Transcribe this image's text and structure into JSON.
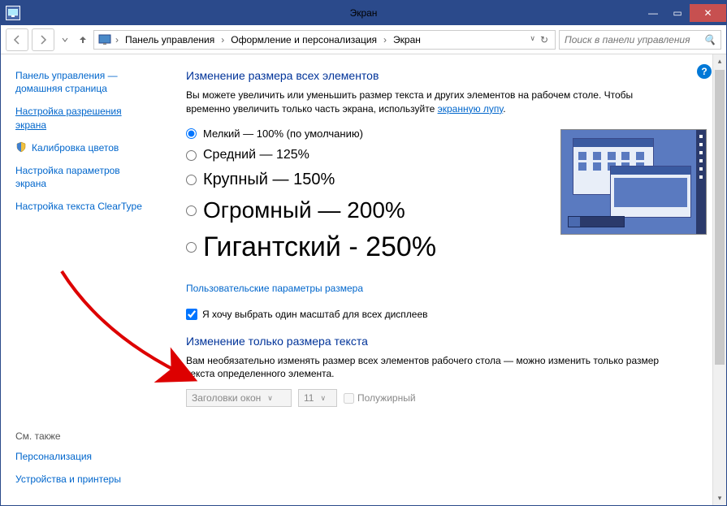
{
  "window": {
    "title": "Экран"
  },
  "breadcrumb": {
    "root": "Панель управления",
    "mid": "Оформление и персонализация",
    "leaf": "Экран"
  },
  "search": {
    "placeholder": "Поиск в панели управления"
  },
  "sidebar": {
    "home1": "Панель управления —",
    "home2": "домашняя страница",
    "resolution1": "Настройка разрешения",
    "resolution2": "экрана",
    "calibration": "Калибровка цветов",
    "params1": "Настройка параметров",
    "params2": "экрана",
    "cleartype": "Настройка текста ClearType",
    "seeAlso": "См. также",
    "personalization": "Персонализация",
    "printers": "Устройства и принтеры"
  },
  "main": {
    "heading": "Изменение размера всех элементов",
    "desc1": "Вы можете увеличить или уменьшить размер текста и других элементов на рабочем столе. Чтобы временно увеличить только часть экрана, используйте ",
    "descLink": "экранную лупу",
    "descEnd": ".",
    "radio100": "Мелкий — 100% (по умолчанию)",
    "radio125": "Средний — 125%",
    "radio150": "Крупный — 150%",
    "radio200": "Огромный — 200%",
    "radio250": "Гигантский - 250%",
    "customLink": "Пользовательские параметры размера",
    "checkboxLabel": "Я хочу выбрать один масштаб для всех дисплеев",
    "textHeading": "Изменение только размера текста",
    "textDesc": "Вам необязательно изменять размер всех элементов рабочего стола — можно изменить только размер текста определенного элемента.",
    "comboElement": "Заголовки окон",
    "comboSize": "11",
    "boldLabel": "Полужирный"
  }
}
